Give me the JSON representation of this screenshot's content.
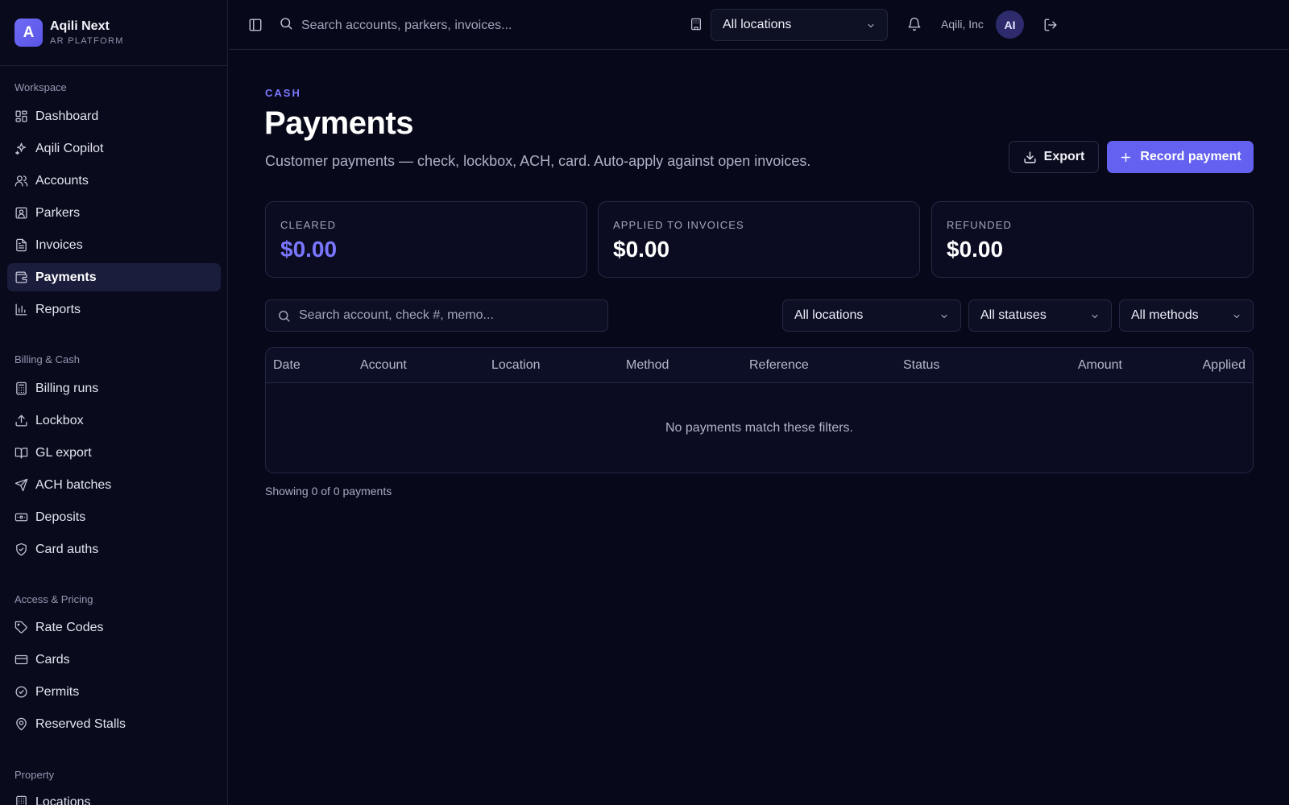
{
  "brand": {
    "logo_letter": "A",
    "name": "Aqili Next",
    "subtitle": "AR PLATFORM"
  },
  "sidebar": {
    "sections": [
      {
        "title": "Workspace",
        "items": [
          {
            "label": "Dashboard",
            "icon": "dashboard-icon"
          },
          {
            "label": "Aqili Copilot",
            "icon": "sparkles-icon"
          },
          {
            "label": "Accounts",
            "icon": "users-icon"
          },
          {
            "label": "Parkers",
            "icon": "id-card-icon"
          },
          {
            "label": "Invoices",
            "icon": "file-text-icon"
          },
          {
            "label": "Payments",
            "icon": "wallet-icon",
            "active": true
          },
          {
            "label": "Reports",
            "icon": "bar-chart-icon"
          }
        ]
      },
      {
        "title": "Billing & Cash",
        "items": [
          {
            "label": "Billing runs",
            "icon": "calculator-icon"
          },
          {
            "label": "Lockbox",
            "icon": "upload-icon"
          },
          {
            "label": "GL export",
            "icon": "book-open-icon"
          },
          {
            "label": "ACH batches",
            "icon": "send-icon"
          },
          {
            "label": "Deposits",
            "icon": "banknote-icon"
          },
          {
            "label": "Card auths",
            "icon": "shield-check-icon"
          }
        ]
      },
      {
        "title": "Access & Pricing",
        "items": [
          {
            "label": "Rate Codes",
            "icon": "tag-icon"
          },
          {
            "label": "Cards",
            "icon": "credit-card-icon"
          },
          {
            "label": "Permits",
            "icon": "badge-check-icon"
          },
          {
            "label": "Reserved Stalls",
            "icon": "map-pin-icon"
          }
        ]
      },
      {
        "title": "Property",
        "items": [
          {
            "label": "Locations",
            "icon": "building-icon"
          }
        ]
      }
    ]
  },
  "topbar": {
    "search_placeholder": "Search accounts, parkers, invoices...",
    "location_select": "All locations",
    "org_name": "Aqili, Inc",
    "avatar_initials": "AI"
  },
  "page": {
    "eyebrow": "CASH",
    "title": "Payments",
    "description": "Customer payments — check, lockbox, ACH, card. Auto-apply against open invoices.",
    "export_label": "Export",
    "record_label": "Record payment"
  },
  "stats": [
    {
      "label": "CLEARED",
      "value": "$0.00",
      "color": "#7a76ff"
    },
    {
      "label": "APPLIED TO INVOICES",
      "value": "$0.00",
      "color": "#ffffff"
    },
    {
      "label": "REFUNDED",
      "value": "$0.00",
      "color": "#ffffff"
    }
  ],
  "filters": {
    "search_placeholder": "Search account, check #, memo...",
    "location": "All locations",
    "status": "All statuses",
    "method": "All methods"
  },
  "table": {
    "columns": [
      "Date",
      "Account",
      "Location",
      "Method",
      "Reference",
      "Status",
      "Amount",
      "Applied"
    ],
    "empty_message": "No payments match these filters.",
    "footer": "Showing 0 of 0 payments"
  },
  "colors": {
    "accent": "#6461f0",
    "background": "#07081a",
    "sidebar": "#090a1c"
  }
}
